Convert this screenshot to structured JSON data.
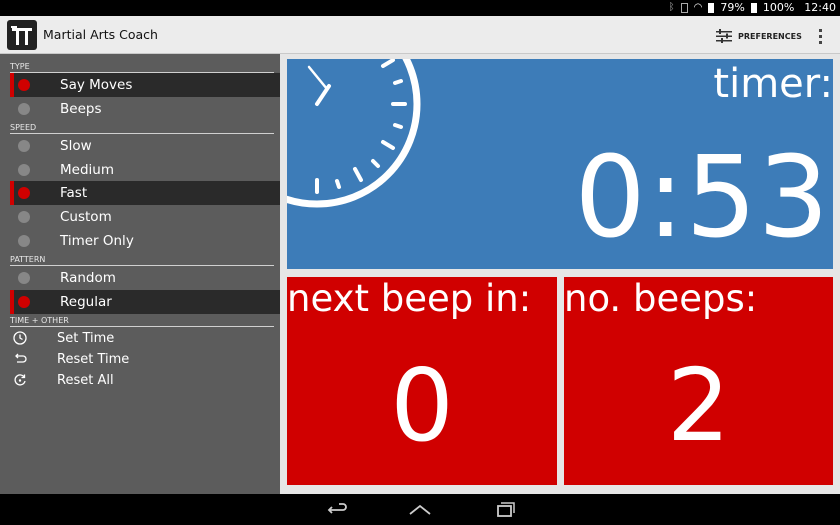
{
  "status_bar": {
    "battery_percent_1": "79%",
    "battery_percent_2": "100%",
    "time": "12:40"
  },
  "app": {
    "title": "Martial Arts Coach",
    "preferences_label": "PREFERENCES"
  },
  "sidebar": {
    "sections": {
      "type": "TYPE",
      "speed": "SPEED",
      "pattern": "PATTERN",
      "time_other": "TIME + OTHER"
    },
    "type_items": [
      {
        "label": "Say Moves",
        "selected": true
      },
      {
        "label": "Beeps",
        "selected": false
      }
    ],
    "speed_items": [
      {
        "label": "Slow",
        "selected": false
      },
      {
        "label": "Medium",
        "selected": false
      },
      {
        "label": "Fast",
        "selected": true
      },
      {
        "label": "Custom",
        "selected": false
      },
      {
        "label": "Timer Only",
        "selected": false
      }
    ],
    "pattern_items": [
      {
        "label": "Random",
        "selected": false
      },
      {
        "label": "Regular",
        "selected": true
      }
    ],
    "actions": [
      {
        "label": "Set Time",
        "icon": "clock-icon"
      },
      {
        "label": "Reset Time",
        "icon": "undo-icon"
      },
      {
        "label": "Reset All",
        "icon": "reset-all-icon"
      }
    ]
  },
  "timer": {
    "label": "timer:",
    "value": "0:53"
  },
  "next_beep": {
    "label": "next beep in:",
    "value": "0"
  },
  "no_beeps": {
    "label": "no. beeps:",
    "value": "2"
  },
  "colors": {
    "timer_panel": "#3d7cb8",
    "red_panel": "#d00000",
    "sidebar": "#5c5c5c",
    "selected_indicator": "#d00000"
  }
}
